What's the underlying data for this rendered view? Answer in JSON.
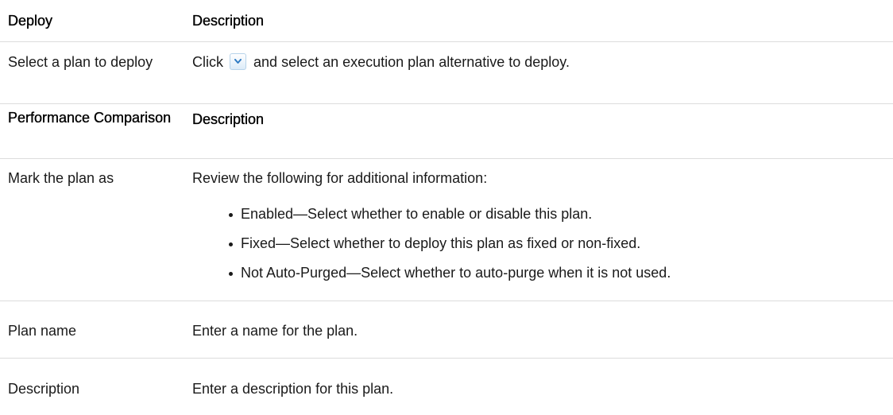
{
  "table1": {
    "header": {
      "col1": "Deploy",
      "col2": "Description"
    },
    "row": {
      "col1": "Select a plan to deploy",
      "col2_prefix": "Click",
      "col2_icon": "dropdown-arrow-icon",
      "col2_suffix": "and select an execution plan alternative to deploy."
    }
  },
  "table2": {
    "header": {
      "col1": "Performance Comparison",
      "col2": "Description"
    },
    "rows": [
      {
        "col1": "Mark the plan as",
        "intro": "Review the following for additional information:",
        "bullets": [
          "Enabled—Select whether to enable or disable this plan.",
          "Fixed—Select whether to deploy this plan as fixed or non-fixed.",
          "Not Auto-Purged—Select whether to auto-purge when it is not used."
        ]
      },
      {
        "col1": "Plan name",
        "col2": "Enter a name for the plan."
      },
      {
        "col1": "Description",
        "col2": "Enter a description for this plan."
      }
    ]
  },
  "colors": {
    "text": "#1a1a1a",
    "divider": "#dcdcdc",
    "dropdown_button_border": "#b7d3ea",
    "dropdown_arrow": "#2f7bc4"
  }
}
